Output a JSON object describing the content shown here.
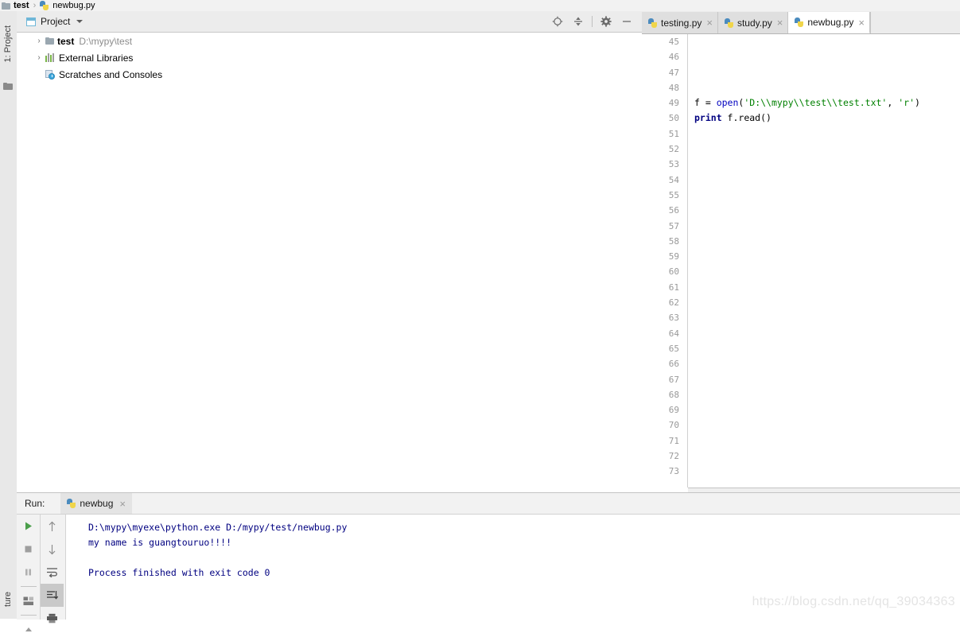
{
  "breadcrumb": {
    "project_label": "test",
    "separator": "›",
    "file_label": "newbug.py",
    "folder_icon": "folder-icon",
    "file_icon": "python-file-icon"
  },
  "left_strip": {
    "project_tab": "1: Project",
    "bottom_tab": "ture",
    "folder_icon": "folder-icon"
  },
  "project_panel": {
    "title": "Project",
    "caret_icon": "chevron-down-icon",
    "toolbar": [
      {
        "name": "locate-icon",
        "title": "Select Opened File"
      },
      {
        "name": "collapse-all-icon",
        "title": "Collapse All"
      },
      {
        "name": "gear-icon",
        "title": "Settings"
      },
      {
        "name": "minimize-icon",
        "title": "Hide"
      }
    ],
    "tree": [
      {
        "twisty": "›",
        "icon": "folder-icon",
        "label": "test",
        "path": "D:\\mypy\\test",
        "bold": true,
        "expandable": true
      },
      {
        "twisty": "›",
        "icon": "libraries-icon",
        "label": "External Libraries",
        "path": "",
        "bold": false,
        "expandable": true
      },
      {
        "twisty": "",
        "icon": "scratches-icon",
        "label": "Scratches and Consoles",
        "path": "",
        "bold": false,
        "expandable": false
      }
    ]
  },
  "editor": {
    "tabs": [
      {
        "label": "testing.py",
        "icon": "python-file-icon",
        "close": "×",
        "active": false
      },
      {
        "label": "study.py",
        "icon": "python-file-icon",
        "close": "×",
        "active": false
      },
      {
        "label": "newbug.py",
        "icon": "python-file-icon",
        "close": "×",
        "active": true
      }
    ],
    "first_line_number": 45,
    "last_line_number": 73,
    "line_numbers": [
      45,
      46,
      47,
      48,
      49,
      50,
      51,
      52,
      53,
      54,
      55,
      56,
      57,
      58,
      59,
      60,
      61,
      62,
      63,
      64,
      65,
      66,
      67,
      68,
      69,
      70,
      71,
      72,
      73
    ],
    "code_lines": [
      {
        "line": 49,
        "tokens": [
          {
            "t": "f = ",
            "c": "plain"
          },
          {
            "t": "open",
            "c": "builtin"
          },
          {
            "t": "(",
            "c": "plain"
          },
          {
            "t": "'D:\\\\mypy\\\\test\\\\test.txt'",
            "c": "str"
          },
          {
            "t": ", ",
            "c": "plain"
          },
          {
            "t": "'r'",
            "c": "str"
          },
          {
            "t": ")",
            "c": "plain"
          }
        ]
      },
      {
        "line": 50,
        "tokens": [
          {
            "t": "print",
            "c": "kw"
          },
          {
            "t": " f.read()",
            "c": "plain"
          }
        ]
      }
    ]
  },
  "run_panel": {
    "label": "Run:",
    "tab_label": "newbug",
    "tab_icon": "python-file-icon",
    "tab_close": "×",
    "side_buttons": [
      {
        "name": "run-icon",
        "color": "#4a9e4a"
      },
      {
        "name": "stop-icon",
        "color": "#9e9e9e"
      },
      {
        "name": "pause-icon",
        "color": "#b0b0b0"
      },
      {
        "name": "layout-icon",
        "color": "#7a7a7a"
      }
    ],
    "side_buttons2": [
      {
        "name": "arrow-up-icon",
        "color": "#8c8c8c"
      },
      {
        "name": "arrow-down-icon",
        "color": "#8c8c8c"
      },
      {
        "name": "soft-wrap-icon",
        "color": "#5a5a5a"
      },
      {
        "name": "scroll-to-end-icon",
        "color": "#3c3c3c",
        "selected": true
      },
      {
        "name": "print-icon",
        "color": "#5a5a5a"
      }
    ],
    "output": [
      "D:\\mypy\\myexe\\python.exe D:/mypy/test/newbug.py",
      "my name is guangtouruo!!!!",
      "",
      "Process finished with exit code 0"
    ]
  },
  "watermark": "https://blog.csdn.net/qq_39034363",
  "colors": {
    "panel_bg": "#f2f2f2",
    "tab_inactive": "#dfdfdf",
    "tab_active": "#ffffff",
    "console_text": "#000080",
    "string_green": "#008000",
    "builtin_blue": "#0000c0",
    "keyword_navy": "#000080",
    "gutter_text": "#999999",
    "watermark": "#e4e4e4"
  }
}
